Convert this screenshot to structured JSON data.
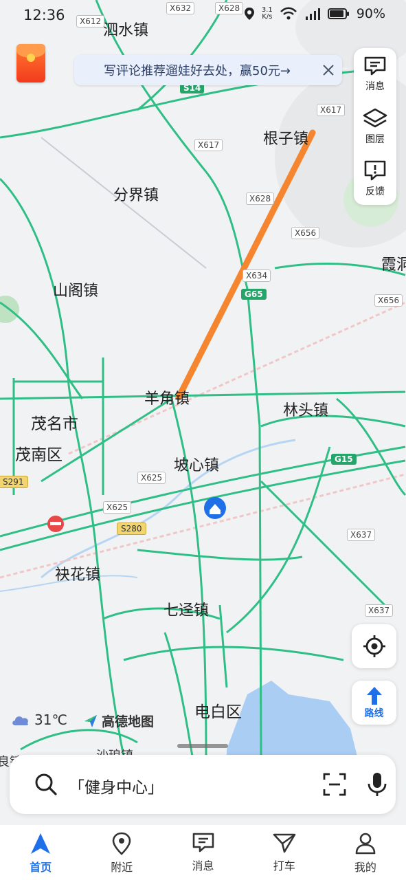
{
  "status_bar": {
    "time": "12:36",
    "speed": "3.1",
    "speed_unit": "K/s",
    "battery": "90%"
  },
  "banner": {
    "text": "写评论推荐遛娃好去处，赢50元→"
  },
  "side_panel": {
    "messages": "消息",
    "layers": "图层",
    "feedback": "反馈"
  },
  "map": {
    "places": {
      "sishui": "泗水镇",
      "genzi": "根子镇",
      "fenjie": "分界镇",
      "shange": "山阁镇",
      "maoming": "茂名市",
      "maonan": "茂南区",
      "yangjiao": "羊角镇",
      "poxin": "坡心镇",
      "lintou": "林头镇",
      "xia": "霞洞",
      "fuhua": "袂花镇",
      "qiyi": "七迳镇",
      "dianbai": "电白区",
      "shapan": "沙琅镇",
      "liang": "良镇"
    },
    "roads": {
      "x632": "X632",
      "x628a": "X628",
      "x612": "X612",
      "s14": "S14",
      "x617a": "X617",
      "x617b": "X617",
      "x628b": "X628",
      "x656a": "X656",
      "x634": "X634",
      "g65": "G65",
      "x656b": "X656",
      "g15": "G15",
      "x625a": "X625",
      "s291": "S291",
      "x625b": "X625",
      "s280": "S280",
      "x637a": "X637",
      "x637b": "X637"
    },
    "colors": {
      "road": "#2fbe86",
      "route_line": "#f5862f",
      "water": "#a9cdf3"
    }
  },
  "locate": {
    "icon": "locate-icon"
  },
  "route_button": {
    "label": "路线"
  },
  "weather": {
    "temp": "31℃"
  },
  "brand": {
    "name": "高德地图"
  },
  "search": {
    "placeholder": "「健身中心」"
  },
  "tabs": [
    {
      "label": "首页"
    },
    {
      "label": "附近"
    },
    {
      "label": "消息"
    },
    {
      "label": "打车"
    },
    {
      "label": "我的"
    }
  ]
}
